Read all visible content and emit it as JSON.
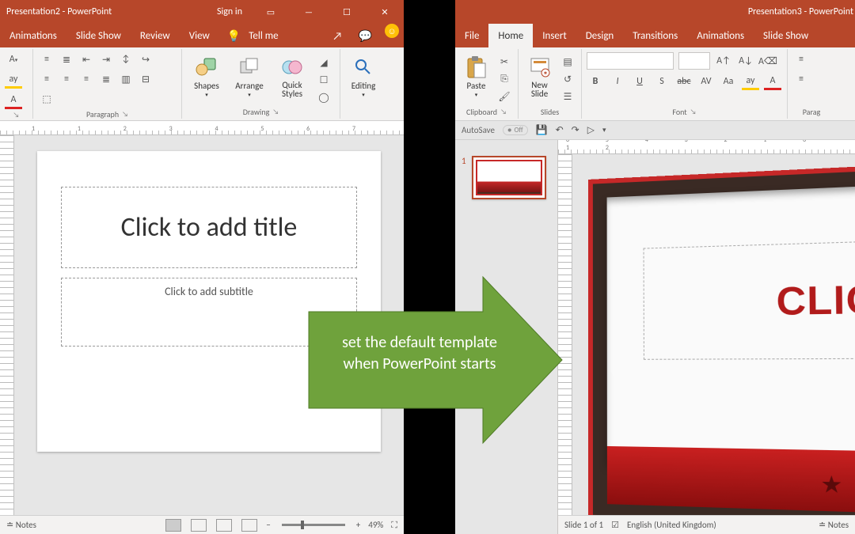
{
  "left": {
    "title": "Presentation2  -  PowerPoint",
    "signin": "Sign in",
    "tabs": {
      "animations": "Animations",
      "slideshow": "Slide Show",
      "review": "Review",
      "view": "View",
      "tellme": "Tell me"
    },
    "ribbon": {
      "paragraph_label": "Paragraph",
      "drawing_label": "Drawing",
      "shapes": "Shapes",
      "arrange": "Arrange",
      "quickstyles": "Quick\nStyles",
      "editing": "Editing"
    },
    "slide": {
      "title_ph": "Click to add title",
      "sub_ph": "Click to add subtitle"
    },
    "status": {
      "notes": "Notes",
      "zoom": "49%"
    }
  },
  "right": {
    "title": "Presentation3  -  PowerPoint",
    "tabs": {
      "file": "File",
      "home": "Home",
      "insert": "Insert",
      "design": "Design",
      "transitions": "Transitions",
      "animations": "Animations",
      "slideshow": "Slide Show"
    },
    "ribbon": {
      "paste": "Paste",
      "clipboard_label": "Clipboard",
      "newslide": "New\nSlide",
      "slides_label": "Slides",
      "font_label": "Font",
      "paragraph_label": "Parag"
    },
    "qat": {
      "autosave": "AutoSave",
      "autosave_state": "Off"
    },
    "thumb_num": "1",
    "slide_title": "CLICK T",
    "status": {
      "slide_counter": "Slide 1 of 1",
      "language": "English (United Kingdom)",
      "notes": "Notes"
    }
  },
  "arrow": {
    "line1": "set the default template",
    "line2": "when PowerPoint starts"
  }
}
